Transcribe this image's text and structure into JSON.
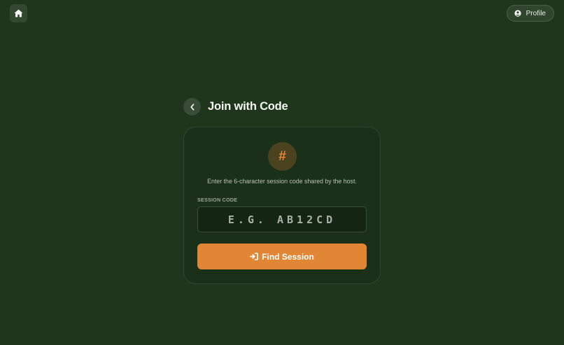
{
  "nav": {
    "home_icon": "home-icon",
    "profile_label": "Profile",
    "profile_icon": "user-circle-icon"
  },
  "header": {
    "back_icon": "chevron-left-icon",
    "title": "Join with Code"
  },
  "card": {
    "icon_glyph": "#",
    "icon_name": "hash-icon",
    "description": "Enter the 6-character session code shared by the host.",
    "code_label": "SESSION CODE",
    "code_value": "",
    "code_placeholder": "E.G. AB12CD",
    "submit_label": "Find Session",
    "submit_icon": "sign-in-icon"
  },
  "colors": {
    "background": "#1f361d",
    "card": "#1b3019",
    "accent": "#e08634",
    "hash_bg": "#4b4220"
  }
}
